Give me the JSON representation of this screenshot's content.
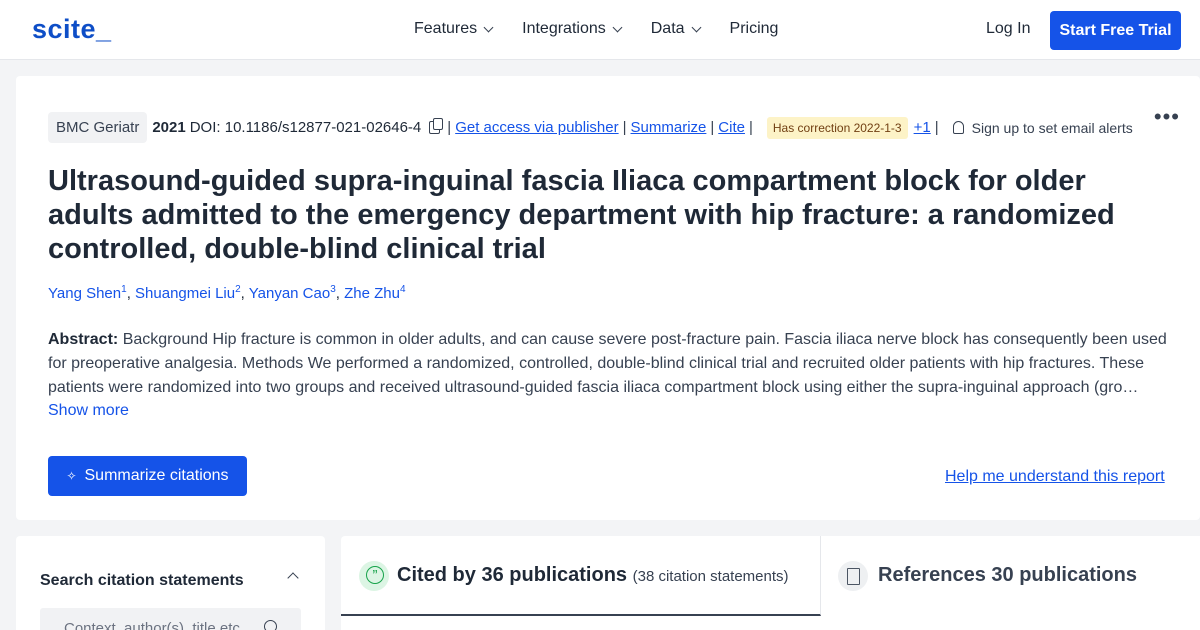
{
  "nav": {
    "logo": "scite_",
    "menu": [
      "Features",
      "Integrations",
      "Data",
      "Pricing"
    ],
    "login": "Log In",
    "trial": "Start Free Trial"
  },
  "paper": {
    "journal": "BMC Geriatr",
    "year": "2021",
    "doi": "DOI: 10.1186/s12877-021-02646-4",
    "links": {
      "access": "Get access via publisher",
      "summarize": "Summarize",
      "cite": "Cite"
    },
    "correction": "Has correction 2022-1-3",
    "plus": "+1",
    "alerts": "Sign up to set email alerts",
    "title": "Ultrasound-guided supra-inguinal fascia Iliaca compartment block for older adults admitted to the emergency department with hip fracture: a randomized controlled, double-blind clinical trial",
    "authors": [
      {
        "name": "Yang Shen",
        "sup": "1"
      },
      {
        "name": "Shuangmei Liu",
        "sup": "2"
      },
      {
        "name": "Yanyan Cao",
        "sup": "3"
      },
      {
        "name": "Zhe Zhu",
        "sup": "4"
      }
    ],
    "abstract_label": "Abstract:",
    "abstract": "Background Hip fracture is common in older adults, and can cause severe post-fracture pain. Fascia iliaca nerve block has consequently been used for preoperative analgesia. Methods We performed a randomized, controlled, double-blind clinical trial and recruited older patients with hip fractures. These patients were randomized into two groups and received ultrasound-guided fascia iliaca compartment block using either the supra-inguinal approach (gro…",
    "show_more": "Show more",
    "summarize_button": "Summarize citations",
    "help_link": "Help me understand this report"
  },
  "search": {
    "title": "Search citation statements",
    "placeholder": "Context, author(s), title etc."
  },
  "tabs": {
    "cited_by": "Cited by 36 publications",
    "cited_sub": "(38 citation statements)",
    "references": "References 30 publications"
  }
}
